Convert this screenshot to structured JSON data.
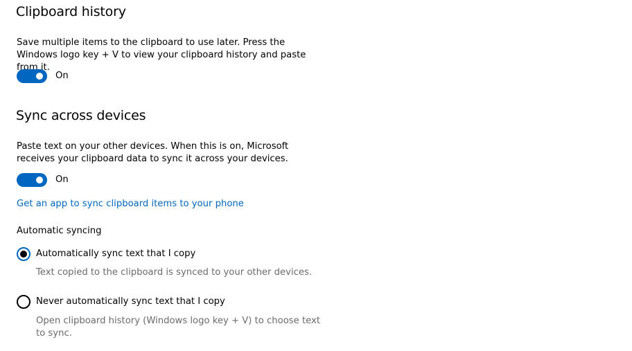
{
  "clipboard_history": {
    "title": "Clipboard history",
    "description": "Save multiple items to the clipboard to use later. Press the Windows logo key + V to view your clipboard history and paste from it.",
    "toggle_state": "On",
    "toggle_on": true
  },
  "sync": {
    "title": "Sync across devices",
    "description": "Paste text on your other devices. When this is on, Microsoft receives your clipboard data to sync it across your devices.",
    "toggle_state": "On",
    "toggle_on": true,
    "link": "Get an app to sync clipboard items to your phone",
    "automatic_label": "Automatic syncing",
    "options": [
      {
        "label": "Automatically sync text that I copy",
        "description": "Text copied to the clipboard is synced to your other devices.",
        "selected": true
      },
      {
        "label": "Never automatically sync text that I copy",
        "description": "Open clipboard history (Windows logo key + V) to choose text to sync.",
        "selected": false
      }
    ]
  },
  "colors": {
    "accent": "#0067c0",
    "secondary_text": "#6b6b6b"
  }
}
